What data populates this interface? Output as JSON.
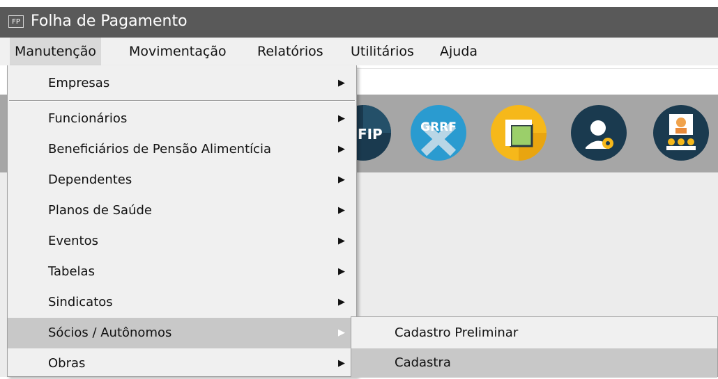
{
  "window": {
    "app_icon_text": "FP",
    "title": "Folha de Pagamento"
  },
  "menubar": {
    "items": [
      {
        "label": "Manutenção",
        "active": true
      },
      {
        "label": "Movimentação"
      },
      {
        "label": "Relatórios"
      },
      {
        "label": "Utilitários"
      },
      {
        "label": "Ajuda"
      }
    ]
  },
  "toolbar": {
    "icons": [
      {
        "name": "sefip-icon",
        "text": "EFIP",
        "color": "#1a3a4f"
      },
      {
        "name": "grrf-icon",
        "text": "GRRF",
        "color": "#2a9bd0"
      },
      {
        "name": "document-icon",
        "color": "#f6b81a"
      },
      {
        "name": "support-settings-icon",
        "color": "#1a3a4f"
      },
      {
        "name": "presentation-users-icon",
        "color": "#1a3a4f"
      }
    ]
  },
  "manutencao_menu": {
    "items": [
      {
        "label": "Empresas",
        "has_submenu": true
      },
      {
        "label": "Funcionários",
        "has_submenu": true
      },
      {
        "label": "Beneficiários de Pensão Alimentícia",
        "has_submenu": true
      },
      {
        "label": "Dependentes",
        "has_submenu": true
      },
      {
        "label": "Planos de Saúde",
        "has_submenu": true
      },
      {
        "label": "Eventos",
        "has_submenu": true
      },
      {
        "label": "Tabelas",
        "has_submenu": true
      },
      {
        "label": "Sindicatos",
        "has_submenu": true
      },
      {
        "label": "Sócios / Autônomos",
        "has_submenu": true,
        "highlighted": true
      },
      {
        "label": "Obras",
        "has_submenu": true
      }
    ],
    "arrow": "▶"
  },
  "socios_submenu": {
    "items": [
      {
        "label": "Cadastro Preliminar"
      },
      {
        "label": "Cadastra",
        "highlighted": true
      }
    ]
  }
}
